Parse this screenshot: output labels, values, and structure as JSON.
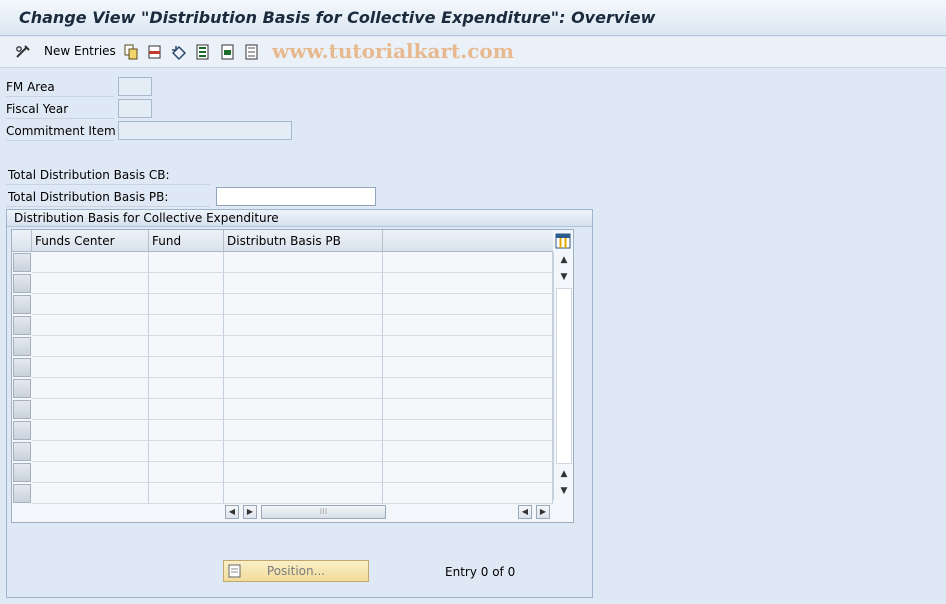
{
  "window": {
    "title": "Change View \"Distribution Basis for Collective Expenditure\": Overview",
    "watermark": "www.tutorialkart.com"
  },
  "toolbar": {
    "new_entries_label": "New Entries",
    "icons": [
      "edit-glasses-icon",
      "copy-icon",
      "delete-icon",
      "undo-icon",
      "select-all-icon",
      "select-block-icon",
      "deselect-all-icon"
    ]
  },
  "fields": {
    "fm_area": {
      "label": "FM Area",
      "value": ""
    },
    "fiscal_year": {
      "label": "Fiscal Year",
      "value": ""
    },
    "commitment_item": {
      "label": "Commitment Item",
      "value": ""
    },
    "total_cb": {
      "label": "Total Distribution Basis CB:",
      "value": ""
    },
    "total_pb": {
      "label": "Total Distribution Basis PB:",
      "value": ""
    }
  },
  "group": {
    "title": "Distribution Basis for Collective Expenditure",
    "columns": [
      "Funds Center",
      "Fund",
      "Distributn Basis PB",
      ""
    ],
    "rows": [
      [
        "",
        "",
        "",
        ""
      ],
      [
        "",
        "",
        "",
        ""
      ],
      [
        "",
        "",
        "",
        ""
      ],
      [
        "",
        "",
        "",
        ""
      ],
      [
        "",
        "",
        "",
        ""
      ],
      [
        "",
        "",
        "",
        ""
      ],
      [
        "",
        "",
        "",
        ""
      ],
      [
        "",
        "",
        "",
        ""
      ],
      [
        "",
        "",
        "",
        ""
      ],
      [
        "",
        "",
        "",
        ""
      ],
      [
        "",
        "",
        "",
        ""
      ],
      [
        "",
        "",
        "",
        ""
      ]
    ]
  },
  "footer": {
    "position_label": "Position...",
    "entry_info": "Entry 0 of 0"
  },
  "colors": {
    "background": "#dfe9f5",
    "position_button": "#f1dc9a"
  }
}
